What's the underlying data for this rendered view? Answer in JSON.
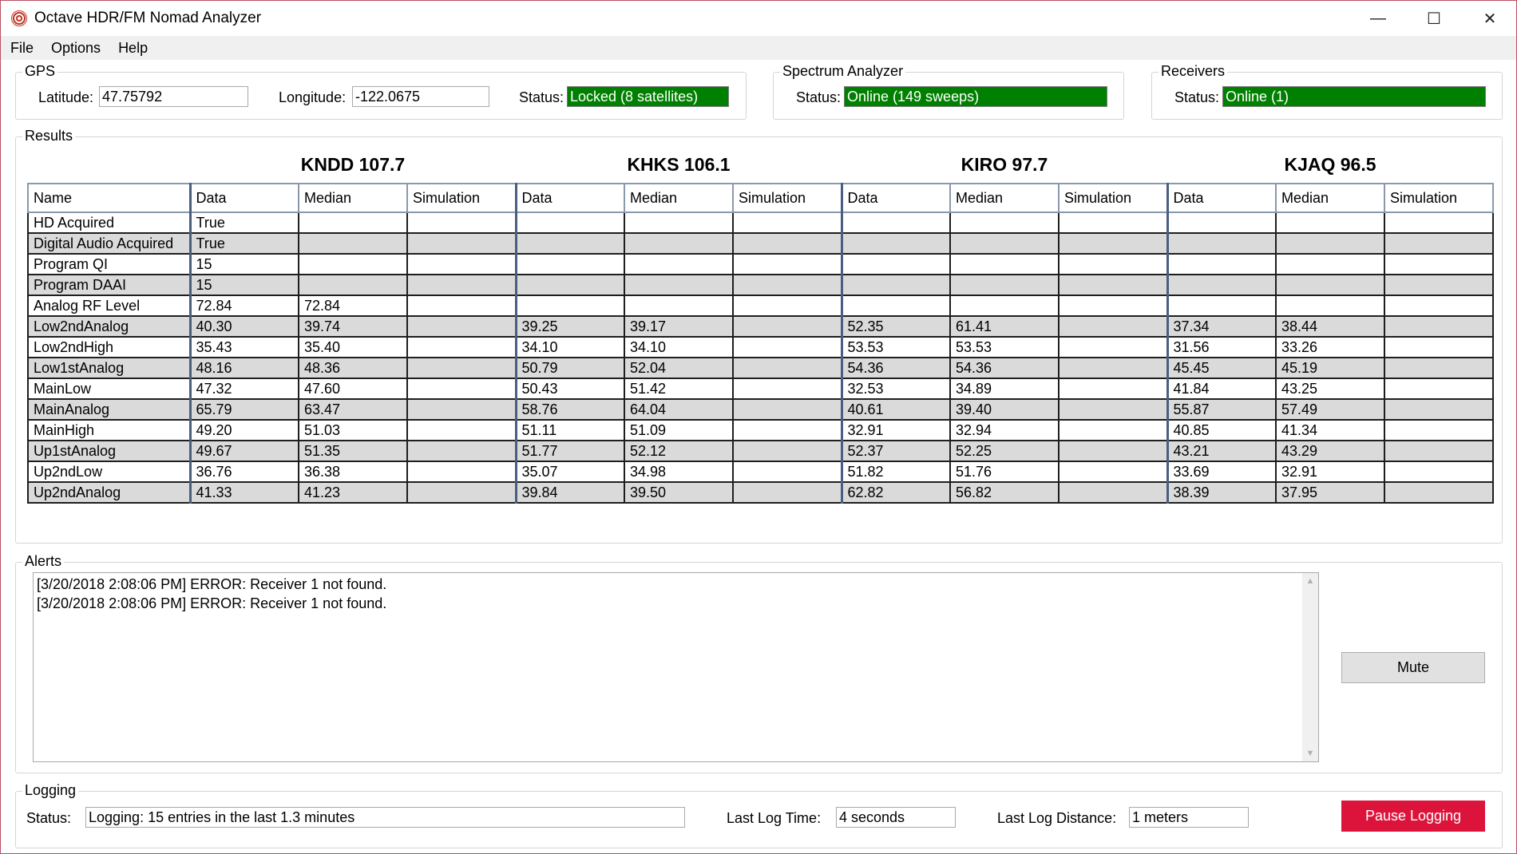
{
  "window": {
    "title": "Octave HDR/FM Nomad Analyzer",
    "minimize": "—",
    "maximize": "☐",
    "close": "✕"
  },
  "menu": [
    "File",
    "Options",
    "Help"
  ],
  "gps": {
    "legend": "GPS",
    "latitude_label": "Latitude:",
    "latitude": "47.75792",
    "longitude_label": "Longitude:",
    "longitude": "-122.0675",
    "status_label": "Status:",
    "status": "Locked (8 satellites)"
  },
  "spectrum": {
    "legend": "Spectrum Analyzer",
    "status_label": "Status:",
    "status": "Online (149 sweeps)"
  },
  "receivers": {
    "legend": "Receivers",
    "status_label": "Status:",
    "status": "Online (1)"
  },
  "results": {
    "legend": "Results",
    "stations": [
      "KNDD 107.7",
      "KHKS 106.1",
      "KIRO 97.7",
      "KJAQ 96.5"
    ],
    "name_header": "Name",
    "sub_headers": [
      "Data",
      "Median",
      "Simulation"
    ],
    "rows": [
      {
        "name": "HD Acquired",
        "cells": [
          "True",
          "",
          "",
          "",
          "",
          "",
          "",
          "",
          "",
          "",
          "",
          ""
        ]
      },
      {
        "name": "Digital Audio Acquired",
        "cells": [
          "True",
          "",
          "",
          "",
          "",
          "",
          "",
          "",
          "",
          "",
          "",
          ""
        ]
      },
      {
        "name": "Program QI",
        "cells": [
          "15",
          "",
          "",
          "",
          "",
          "",
          "",
          "",
          "",
          "",
          "",
          ""
        ]
      },
      {
        "name": "Program DAAI",
        "cells": [
          "15",
          "",
          "",
          "",
          "",
          "",
          "",
          "",
          "",
          "",
          "",
          ""
        ]
      },
      {
        "name": "Analog RF Level",
        "cells": [
          "72.84",
          "72.84",
          "",
          "",
          "",
          "",
          "",
          "",
          "",
          "",
          "",
          ""
        ]
      },
      {
        "name": "Low2ndAnalog",
        "cells": [
          "40.30",
          "39.74",
          "",
          "39.25",
          "39.17",
          "",
          "52.35",
          "61.41",
          "",
          "37.34",
          "38.44",
          ""
        ]
      },
      {
        "name": "Low2ndHigh",
        "cells": [
          "35.43",
          "35.40",
          "",
          "34.10",
          "34.10",
          "",
          "53.53",
          "53.53",
          "",
          "31.56",
          "33.26",
          ""
        ]
      },
      {
        "name": "Low1stAnalog",
        "cells": [
          "48.16",
          "48.36",
          "",
          "50.79",
          "52.04",
          "",
          "54.36",
          "54.36",
          "",
          "45.45",
          "45.19",
          ""
        ]
      },
      {
        "name": "MainLow",
        "cells": [
          "47.32",
          "47.60",
          "",
          "50.43",
          "51.42",
          "",
          "32.53",
          "34.89",
          "",
          "41.84",
          "43.25",
          ""
        ]
      },
      {
        "name": "MainAnalog",
        "cells": [
          "65.79",
          "63.47",
          "",
          "58.76",
          "64.04",
          "",
          "40.61",
          "39.40",
          "",
          "55.87",
          "57.49",
          ""
        ]
      },
      {
        "name": "MainHigh",
        "cells": [
          "49.20",
          "51.03",
          "",
          "51.11",
          "51.09",
          "",
          "32.91",
          "32.94",
          "",
          "40.85",
          "41.34",
          ""
        ]
      },
      {
        "name": "Up1stAnalog",
        "cells": [
          "49.67",
          "51.35",
          "",
          "51.77",
          "52.12",
          "",
          "52.37",
          "52.25",
          "",
          "43.21",
          "43.29",
          ""
        ]
      },
      {
        "name": "Up2ndLow",
        "cells": [
          "36.76",
          "36.38",
          "",
          "35.07",
          "34.98",
          "",
          "51.82",
          "51.76",
          "",
          "33.69",
          "32.91",
          ""
        ]
      },
      {
        "name": "Up2ndAnalog",
        "cells": [
          "41.33",
          "41.23",
          "",
          "39.84",
          "39.50",
          "",
          "62.82",
          "56.82",
          "",
          "38.39",
          "37.95",
          ""
        ]
      }
    ]
  },
  "alerts": {
    "legend": "Alerts",
    "lines": [
      "[3/20/2018 2:08:06 PM] ERROR: Receiver 1 not found.",
      "[3/20/2018 2:08:06 PM] ERROR: Receiver 1 not found."
    ],
    "mute_label": "Mute"
  },
  "logging": {
    "legend": "Logging",
    "status_label": "Status:",
    "status": "Logging: 15 entries in the last 1.3 minutes",
    "last_time_label": "Last Log Time:",
    "last_time": "4 seconds",
    "last_distance_label": "Last Log Distance:",
    "last_distance": "1 meters",
    "pause_label": "Pause Logging"
  },
  "colors": {
    "status_ok": "#008000",
    "pause_button": "#dc143c",
    "alt_row": "#dadada"
  }
}
